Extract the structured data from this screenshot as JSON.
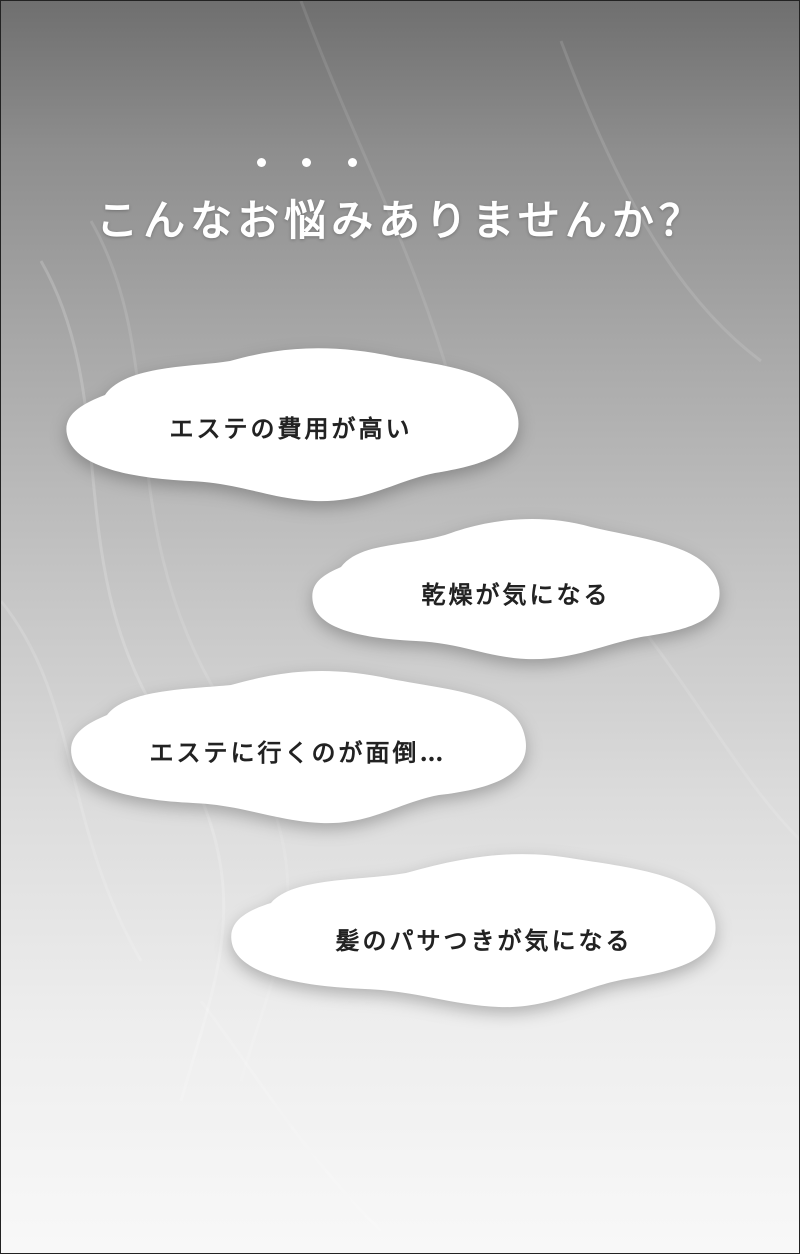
{
  "title": "こんなお悩みありませんか？",
  "title_dots": [
    "dot",
    "dot",
    "dot"
  ],
  "worries": [
    {
      "text": "エステの費用が高い"
    },
    {
      "text": "乾燥が気になる"
    },
    {
      "text": "エステに行くのが面倒…"
    },
    {
      "text": "髪のパサつきが気になる"
    }
  ],
  "colors": {
    "background_top": "#6f6f6f",
    "background_bottom": "#f8f8f8",
    "cloud_fill": "#ffffff",
    "title_text": "#ffffff",
    "cloud_text": "#222222"
  }
}
